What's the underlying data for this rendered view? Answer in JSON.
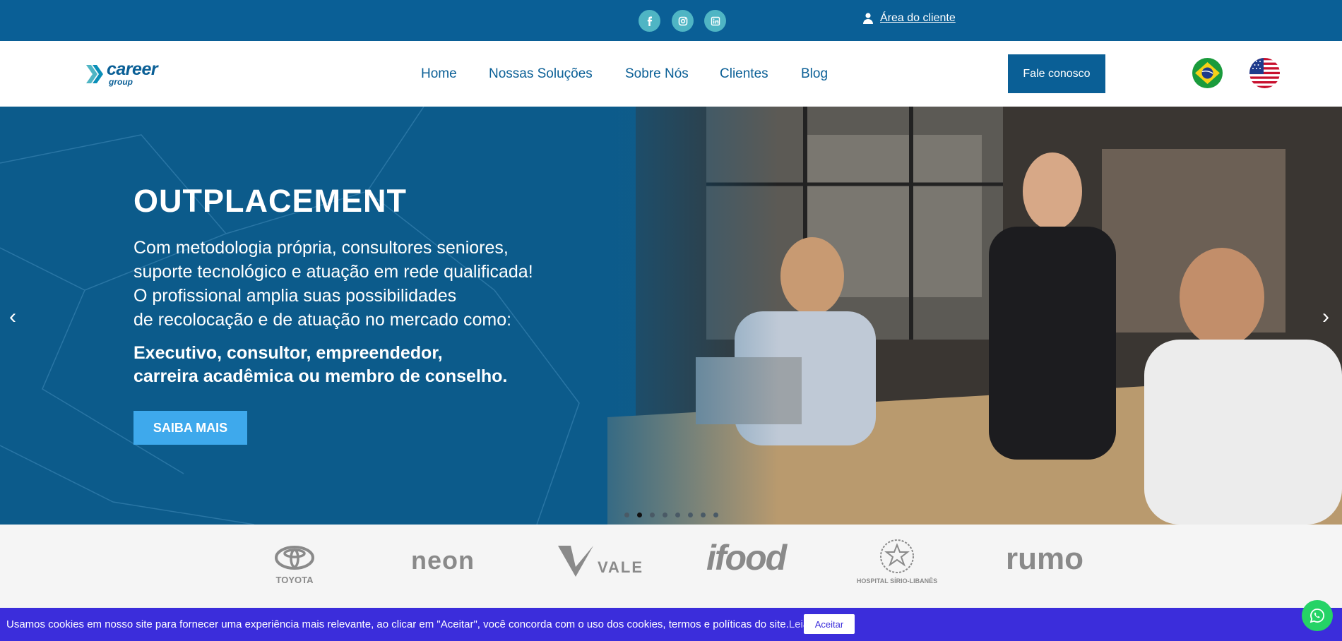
{
  "topbar": {
    "socials": [
      {
        "icon": "facebook-icon",
        "glyph": "f"
      },
      {
        "icon": "instagram-icon",
        "glyph": ""
      },
      {
        "icon": "linkedin-icon",
        "glyph": ""
      }
    ],
    "client_area": "Área do cliente"
  },
  "header": {
    "logo": {
      "name": "career",
      "sub": "group"
    },
    "nav": [
      "Home",
      "Nossas Soluções",
      "Sobre Nós",
      "Clientes",
      "Blog"
    ],
    "cta": "Fale conosco",
    "flags": [
      "brazil-flag-icon",
      "usa-flag-icon"
    ]
  },
  "hero": {
    "title": "OUTPLACEMENT",
    "desc_lines": [
      "Com metodologia própria, consultores seniores,",
      "suporte tecnológico e atuação em rede qualificada!",
      "O profissional amplia suas possibilidades",
      "de recolocação e de atuação no mercado como:"
    ],
    "bold_lines": [
      "Executivo, consultor, empreendedor,",
      "carreira acadêmica ou membro de conselho."
    ],
    "button": "SAIBA MAIS",
    "prev": "‹",
    "next": "›",
    "slide_count": 8,
    "active_slide": 2
  },
  "clients": [
    "TOYOTA",
    "neon",
    "VALE",
    "ifood",
    "HOSPITAL SÍRIO-LIBANÊS",
    "rumo"
  ],
  "cookie": {
    "text": "Usamos cookies em nosso site para fornecer uma experiência mais relevante, ao clicar em \"Aceitar\", você concorda com o uso dos cookies, termos e políticas do site.",
    "link": "Leia Mais",
    "button": "Aceitar"
  },
  "colors": {
    "primary": "#0a5f96",
    "social": "#4fb5c4",
    "hero_button": "#3ea9ec",
    "cookie_bar": "#3b2ddb",
    "whatsapp": "#25d366"
  }
}
